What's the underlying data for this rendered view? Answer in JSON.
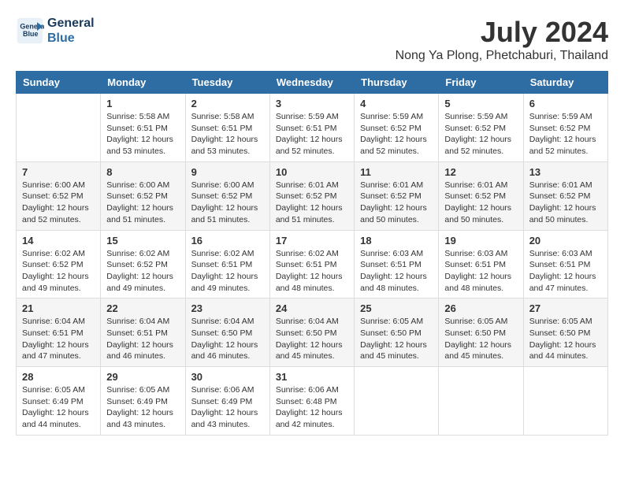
{
  "logo": {
    "line1": "General",
    "line2": "Blue"
  },
  "title": "July 2024",
  "location": "Nong Ya Plong, Phetchaburi, Thailand",
  "days_of_week": [
    "Sunday",
    "Monday",
    "Tuesday",
    "Wednesday",
    "Thursday",
    "Friday",
    "Saturday"
  ],
  "weeks": [
    [
      {
        "day": "",
        "info": ""
      },
      {
        "day": "1",
        "info": "Sunrise: 5:58 AM\nSunset: 6:51 PM\nDaylight: 12 hours\nand 53 minutes."
      },
      {
        "day": "2",
        "info": "Sunrise: 5:58 AM\nSunset: 6:51 PM\nDaylight: 12 hours\nand 53 minutes."
      },
      {
        "day": "3",
        "info": "Sunrise: 5:59 AM\nSunset: 6:51 PM\nDaylight: 12 hours\nand 52 minutes."
      },
      {
        "day": "4",
        "info": "Sunrise: 5:59 AM\nSunset: 6:52 PM\nDaylight: 12 hours\nand 52 minutes."
      },
      {
        "day": "5",
        "info": "Sunrise: 5:59 AM\nSunset: 6:52 PM\nDaylight: 12 hours\nand 52 minutes."
      },
      {
        "day": "6",
        "info": "Sunrise: 5:59 AM\nSunset: 6:52 PM\nDaylight: 12 hours\nand 52 minutes."
      }
    ],
    [
      {
        "day": "7",
        "info": "Sunrise: 6:00 AM\nSunset: 6:52 PM\nDaylight: 12 hours\nand 52 minutes."
      },
      {
        "day": "8",
        "info": "Sunrise: 6:00 AM\nSunset: 6:52 PM\nDaylight: 12 hours\nand 51 minutes."
      },
      {
        "day": "9",
        "info": "Sunrise: 6:00 AM\nSunset: 6:52 PM\nDaylight: 12 hours\nand 51 minutes."
      },
      {
        "day": "10",
        "info": "Sunrise: 6:01 AM\nSunset: 6:52 PM\nDaylight: 12 hours\nand 51 minutes."
      },
      {
        "day": "11",
        "info": "Sunrise: 6:01 AM\nSunset: 6:52 PM\nDaylight: 12 hours\nand 50 minutes."
      },
      {
        "day": "12",
        "info": "Sunrise: 6:01 AM\nSunset: 6:52 PM\nDaylight: 12 hours\nand 50 minutes."
      },
      {
        "day": "13",
        "info": "Sunrise: 6:01 AM\nSunset: 6:52 PM\nDaylight: 12 hours\nand 50 minutes."
      }
    ],
    [
      {
        "day": "14",
        "info": "Sunrise: 6:02 AM\nSunset: 6:52 PM\nDaylight: 12 hours\nand 49 minutes."
      },
      {
        "day": "15",
        "info": "Sunrise: 6:02 AM\nSunset: 6:52 PM\nDaylight: 12 hours\nand 49 minutes."
      },
      {
        "day": "16",
        "info": "Sunrise: 6:02 AM\nSunset: 6:51 PM\nDaylight: 12 hours\nand 49 minutes."
      },
      {
        "day": "17",
        "info": "Sunrise: 6:02 AM\nSunset: 6:51 PM\nDaylight: 12 hours\nand 48 minutes."
      },
      {
        "day": "18",
        "info": "Sunrise: 6:03 AM\nSunset: 6:51 PM\nDaylight: 12 hours\nand 48 minutes."
      },
      {
        "day": "19",
        "info": "Sunrise: 6:03 AM\nSunset: 6:51 PM\nDaylight: 12 hours\nand 48 minutes."
      },
      {
        "day": "20",
        "info": "Sunrise: 6:03 AM\nSunset: 6:51 PM\nDaylight: 12 hours\nand 47 minutes."
      }
    ],
    [
      {
        "day": "21",
        "info": "Sunrise: 6:04 AM\nSunset: 6:51 PM\nDaylight: 12 hours\nand 47 minutes."
      },
      {
        "day": "22",
        "info": "Sunrise: 6:04 AM\nSunset: 6:51 PM\nDaylight: 12 hours\nand 46 minutes."
      },
      {
        "day": "23",
        "info": "Sunrise: 6:04 AM\nSunset: 6:50 PM\nDaylight: 12 hours\nand 46 minutes."
      },
      {
        "day": "24",
        "info": "Sunrise: 6:04 AM\nSunset: 6:50 PM\nDaylight: 12 hours\nand 45 minutes."
      },
      {
        "day": "25",
        "info": "Sunrise: 6:05 AM\nSunset: 6:50 PM\nDaylight: 12 hours\nand 45 minutes."
      },
      {
        "day": "26",
        "info": "Sunrise: 6:05 AM\nSunset: 6:50 PM\nDaylight: 12 hours\nand 45 minutes."
      },
      {
        "day": "27",
        "info": "Sunrise: 6:05 AM\nSunset: 6:50 PM\nDaylight: 12 hours\nand 44 minutes."
      }
    ],
    [
      {
        "day": "28",
        "info": "Sunrise: 6:05 AM\nSunset: 6:49 PM\nDaylight: 12 hours\nand 44 minutes."
      },
      {
        "day": "29",
        "info": "Sunrise: 6:05 AM\nSunset: 6:49 PM\nDaylight: 12 hours\nand 43 minutes."
      },
      {
        "day": "30",
        "info": "Sunrise: 6:06 AM\nSunset: 6:49 PM\nDaylight: 12 hours\nand 43 minutes."
      },
      {
        "day": "31",
        "info": "Sunrise: 6:06 AM\nSunset: 6:48 PM\nDaylight: 12 hours\nand 42 minutes."
      },
      {
        "day": "",
        "info": ""
      },
      {
        "day": "",
        "info": ""
      },
      {
        "day": "",
        "info": ""
      }
    ]
  ]
}
